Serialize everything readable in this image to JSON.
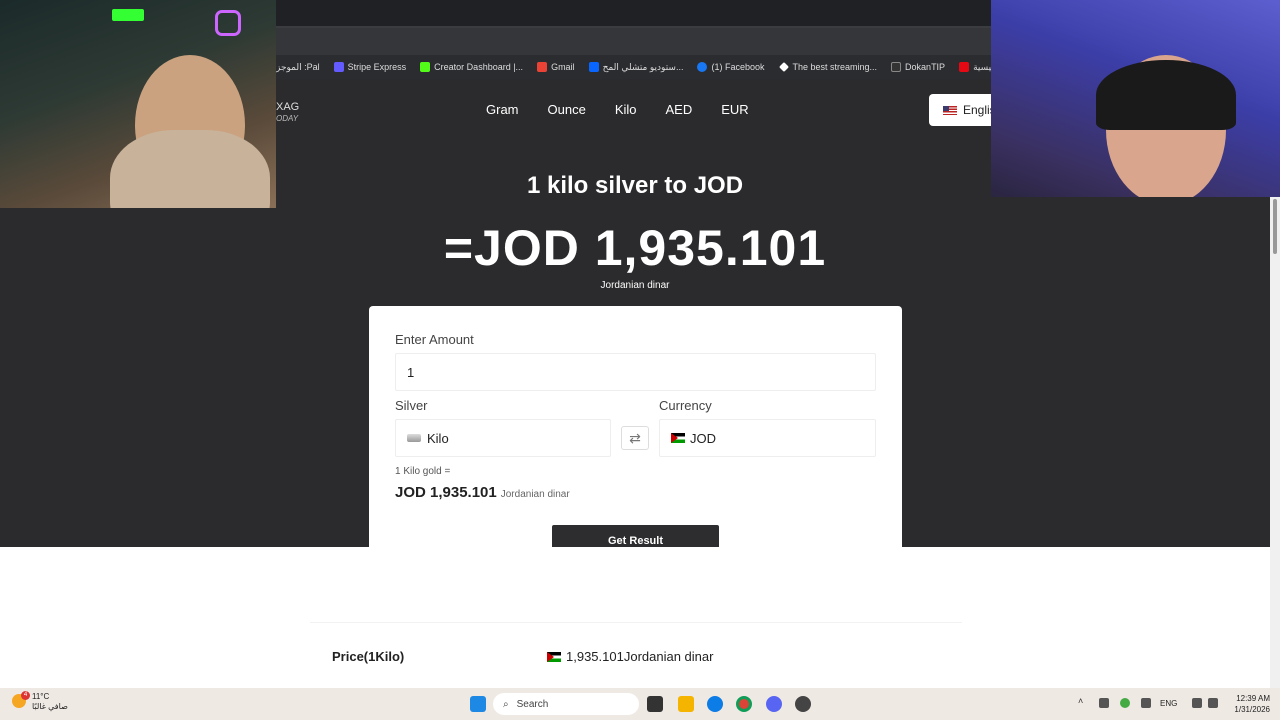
{
  "bookmarks": [
    "الموجز :Pal",
    "Stripe Express",
    "Creator Dashboard |...",
    "Gmail",
    "ستوديو متشلي المح...",
    "(1) Facebook",
    "The best streaming...",
    "DokanTIP",
    "الصفحة الرئيسية - Ne..."
  ],
  "site": {
    "logo_main": "XAG",
    "logo_sub": "ODAY",
    "nav": [
      "Gram",
      "Ounce",
      "Kilo",
      "AED",
      "EUR"
    ],
    "language": "English",
    "headline": "1 kilo silver to JOD",
    "result": "=JOD 1,935.101",
    "result_sub": "Jordanian dinar"
  },
  "form": {
    "amount_label": "Enter Amount",
    "amount_value": "1",
    "silver_label": "Silver",
    "silver_value": "Kilo",
    "currency_label": "Currency",
    "currency_value": "JOD",
    "swap_symbol": "⇄",
    "conversion_note": "1 Kilo gold =",
    "conversion_value": "JOD 1,935.101",
    "conversion_unit": "Jordanian dinar",
    "button_label": "Get Result"
  },
  "table": {
    "row_label": "Price(1Kilo)",
    "row_value": "1,935.101Jordanian dinar"
  },
  "taskbar": {
    "temperature": "11°C",
    "weather_text": "صافي غالبًا",
    "notification_count": "4",
    "search_placeholder": "Search",
    "language": "ENG",
    "time": "12:39 AM",
    "date": "1/31/2026"
  }
}
